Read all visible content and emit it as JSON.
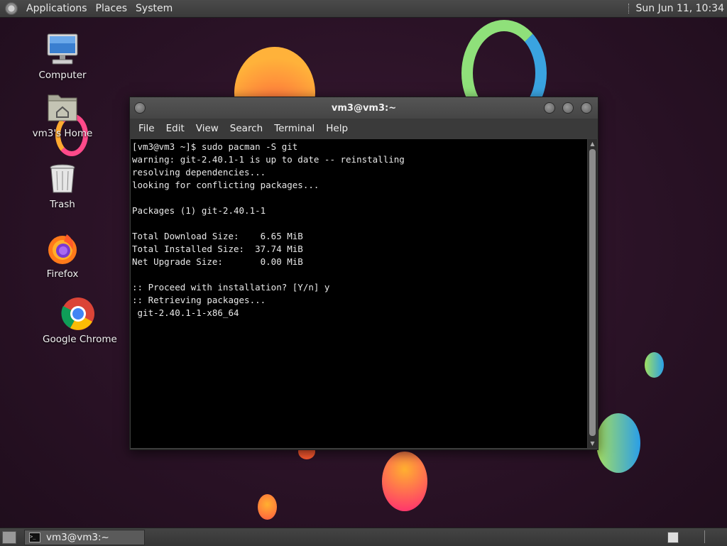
{
  "top_panel": {
    "menus": [
      "Applications",
      "Places",
      "System"
    ],
    "clock": "Sun Jun 11, 10:34"
  },
  "desktop": {
    "icons": [
      {
        "label": "Computer",
        "icon": "computer-icon"
      },
      {
        "label": "vm3's Home",
        "icon": "home-folder-icon"
      },
      {
        "label": "Trash",
        "icon": "trash-icon"
      },
      {
        "label": "Firefox",
        "icon": "firefox-icon"
      },
      {
        "label": "Google Chrome",
        "icon": "chrome-icon"
      }
    ]
  },
  "terminal": {
    "title": "vm3@vm3:~",
    "menu": [
      "File",
      "Edit",
      "View",
      "Search",
      "Terminal",
      "Help"
    ],
    "lines": [
      "[vm3@vm3 ~]$ sudo pacman -S git",
      "warning: git-2.40.1-1 is up to date -- reinstalling",
      "resolving dependencies...",
      "looking for conflicting packages...",
      "",
      "Packages (1) git-2.40.1-1",
      "",
      "Total Download Size:    6.65 MiB",
      "Total Installed Size:  37.74 MiB",
      "Net Upgrade Size:       0.00 MiB",
      "",
      ":: Proceed with installation? [Y/n] y",
      ":: Retrieving packages...",
      " git-2.40.1-1-x86_64"
    ]
  },
  "bottom_panel": {
    "task_label": "vm3@vm3:~"
  },
  "colors": {
    "background": "#2a1226",
    "terminal_bg": "#000000",
    "panel": "#3e3e3e"
  }
}
